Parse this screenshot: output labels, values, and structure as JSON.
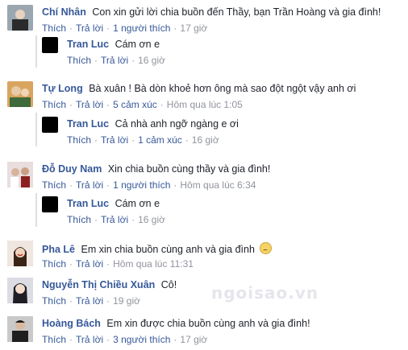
{
  "comments": [
    {
      "name": "Chí Nhân",
      "text": "Con xin gửi lời chia buồn đến Thầy, bạn Trần Hoàng và gia đình!",
      "like": "Thích",
      "reply": "Trả lời",
      "reactions": "1 người thích",
      "time": "17 giờ",
      "avatar_color": "#7a8c9a",
      "replies": [
        {
          "name": "Tran Luc",
          "text": "Cám ơn e",
          "like": "Thích",
          "reply": "Trả lời",
          "time": "16 giờ"
        }
      ]
    },
    {
      "name": "Tự Long",
      "text": "Bà xuân ! Bà dòn khoẻ hơn ông mà sao đột ngột vậy anh ơi",
      "like": "Thích",
      "reply": "Trả lời",
      "reactions": "5 cảm xúc",
      "time": "Hôm qua lúc 1:05",
      "avatar_color": "#c98a3c",
      "replies": [
        {
          "name": "Tran Luc",
          "text": "Cả nhà anh ngỡ ngàng e ơi",
          "like": "Thích",
          "reply": "Trả lời",
          "reactions": "1 cảm xúc",
          "time": "16 giờ"
        }
      ]
    },
    {
      "name": "Đỗ Duy Nam",
      "text": "Xin chia buồn cùng thầy và gia đình!",
      "like": "Thích",
      "reply": "Trả lời",
      "reactions": "1 người thích",
      "time": "Hôm qua lúc 6:34",
      "avatar_color": "#b35b5b",
      "replies": [
        {
          "name": "Tran Luc",
          "text": "Cám ơn e",
          "like": "Thích",
          "reply": "Trả lời",
          "time": "16 giờ"
        }
      ]
    },
    {
      "name": "Pha Lê",
      "text": "Em xin chia buồn cùng anh và gia đình",
      "like": "Thích",
      "reply": "Trả lời",
      "time": "Hôm qua lúc 11:31",
      "avatar_color": "#8a5a4a"
    },
    {
      "name": "Nguyễn Thị Chiều Xuân",
      "text": "Cô!",
      "like": "Thích",
      "reply": "Trả lời",
      "time": "19 giờ",
      "avatar_color": "#5a5a6a"
    },
    {
      "name": "Hoàng Bách",
      "text": "Em xin được chia buồn cùng anh và gia đình!",
      "like": "Thích",
      "reply": "Trả lời",
      "reactions": "3 người thích",
      "time": "17 giờ",
      "avatar_color": "#3a3a3a"
    }
  ],
  "watermark": "ngoisao.vn"
}
